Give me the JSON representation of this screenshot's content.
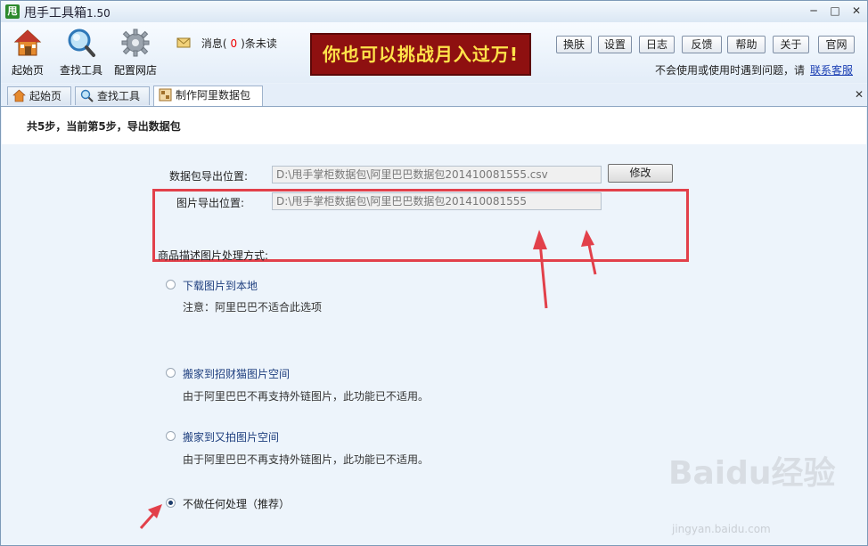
{
  "window": {
    "title": "甩手工具箱",
    "version": "1.50",
    "icon_char": "甩"
  },
  "toolbar": {
    "home_label": "起始页",
    "find_tool_label": "查找工具",
    "config_shop_label": "配置网店",
    "message_prefix": "消息(",
    "message_count": "0",
    "message_suffix": ")条未读",
    "banner_text": "你也可以挑战月入过万!",
    "buttons": [
      "换肤",
      "设置",
      "日志",
      "反馈",
      "帮助",
      "关于",
      "官网"
    ],
    "help_text": "不会使用或使用时遇到问题，请",
    "help_link": "联系客服"
  },
  "tabs": [
    "起始页",
    "查找工具",
    "制作阿里数据包"
  ],
  "content": {
    "step_text": "共5步，当前第5步，导出数据包",
    "export_path_label": "数据包导出位置:",
    "export_path_value": "D:\\甩手掌柜数据包\\阿里巴巴数据包201410081555.csv",
    "image_path_label": "图片导出位置:",
    "image_path_value": "D:\\甩手掌柜数据包\\阿里巴巴数据包201410081555",
    "modify_label": "修改",
    "section_title": "商品描述图片处理方式:",
    "options": [
      {
        "label": "下载图片到本地",
        "note": "注意：阿里巴巴不适合此选项",
        "selected": false
      },
      {
        "label": "搬家到招财猫图片空间",
        "note": "由于阿里巴巴不再支持外链图片，此功能已不适用。",
        "selected": false
      },
      {
        "label": "搬家到又拍图片空间",
        "note": "由于阿里巴巴不再支持外链图片，此功能已不适用。",
        "selected": false
      },
      {
        "label": "不做任何处理（推荐）",
        "note": "",
        "selected": true
      }
    ]
  },
  "colors": {
    "annotation": "#e2404a",
    "banner_bg": "#8e1010",
    "banner_text": "#ffe34a",
    "link": "#1b3fb3"
  },
  "watermark": {
    "brand": "Baidu经验",
    "url": "jingyan.baidu.com"
  }
}
